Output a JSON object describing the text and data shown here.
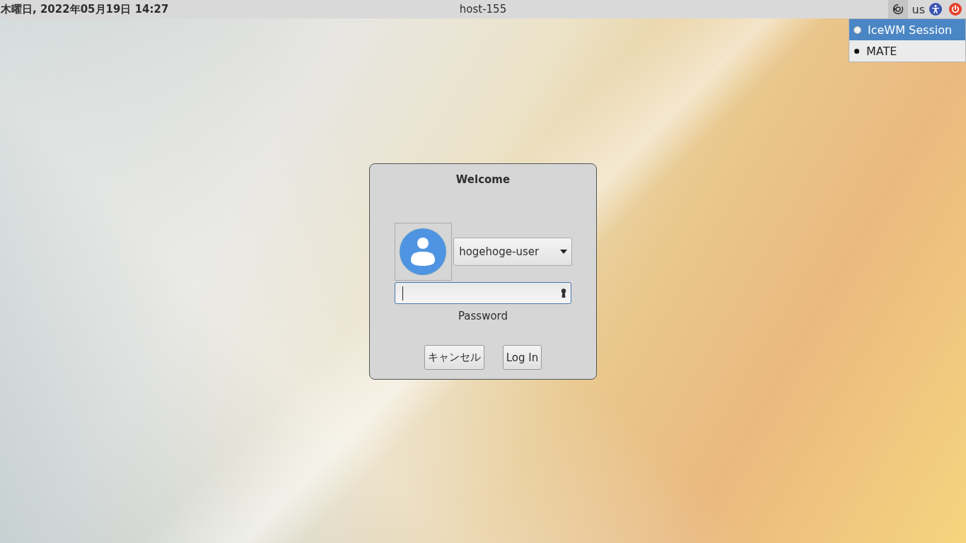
{
  "top_bar": {
    "clock": "木曜日, 2022年05月19日 14:27",
    "hostname": "host-155",
    "keyboard_layout": "us",
    "session_menu_open": true
  },
  "session_menu": [
    {
      "label": "IceWM Session",
      "selected": false,
      "highlighted": true
    },
    {
      "label": "MATE",
      "selected": true,
      "highlighted": false
    }
  ],
  "login_dialog": {
    "title": "Welcome",
    "user": "hogehoge-user",
    "password_label": "Password",
    "buttons": [
      "キャンセル",
      "Log In"
    ]
  }
}
